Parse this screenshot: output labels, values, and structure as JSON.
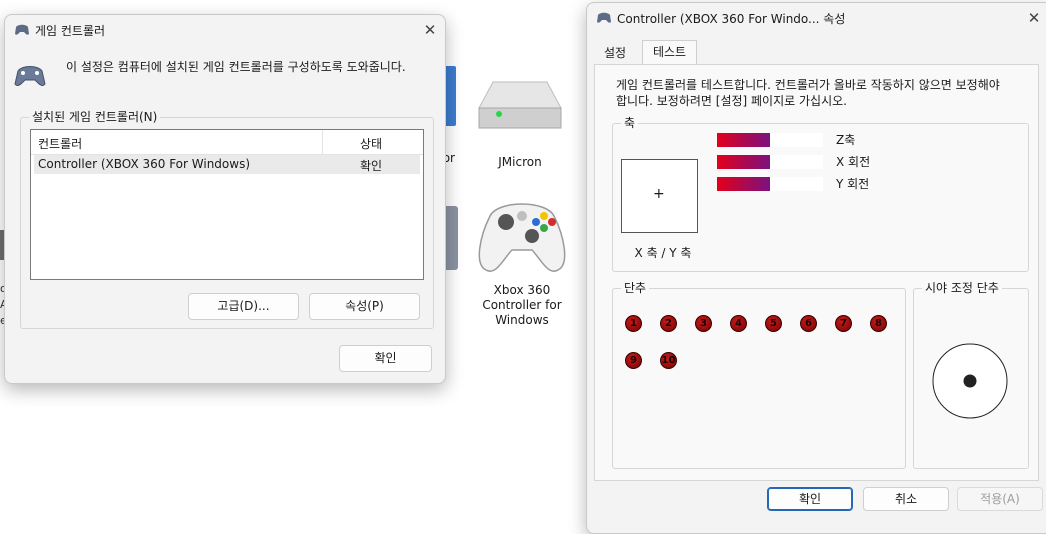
{
  "desktop": {
    "jmicron_label": "JMicron",
    "xbox_label_1": "Xbox 360",
    "xbox_label_2": "Controller for",
    "xbox_label_3": "Windows",
    "partial_tor": "tor",
    "partial_left_1": "o",
    "partial_left_2": "A",
    "partial_left_3": "e"
  },
  "game_controllers": {
    "title": "게임 컨트롤러",
    "description": "이 설정은 컴퓨터에 설치된 게임 컨트롤러를 구성하도록 도와줍니다.",
    "group_label": "설치된 게임 컨트롤러(N)",
    "columns": {
      "controller": "컨트롤러",
      "status": "상태"
    },
    "rows": [
      {
        "controller": "Controller (XBOX 360 For Windows)",
        "status": "확인"
      }
    ],
    "advanced_button": "고급(D)...",
    "properties_button": "속성(P)",
    "ok_button": "확인"
  },
  "properties": {
    "title": "Controller (XBOX 360 For Windo... 속성",
    "tabs": [
      {
        "label": "설정"
      },
      {
        "label": "테스트"
      }
    ],
    "active_tab": "테스트",
    "description_line1": "게임 컨트롤러를 테스트합니다. 컨트롤러가 올바로 작동하지 않으면 보정해야",
    "description_line2": "합니다. 보정하려면 [설정] 페이지로 가십시오.",
    "axes_group": "축",
    "xy_label": "X 축 / Y 축",
    "axis_bars": [
      {
        "label": "Z축",
        "level": 0.5
      },
      {
        "label": "X 회전",
        "level": 0.5
      },
      {
        "label": "Y 회전",
        "level": 0.5
      }
    ],
    "buttons_group": "단추",
    "buttons": [
      "1",
      "2",
      "3",
      "4",
      "5",
      "6",
      "7",
      "8",
      "9",
      "10"
    ],
    "pov_group": "시야 조정 단추",
    "ok_button": "확인",
    "cancel_button": "취소",
    "apply_button": "적용(A)",
    "colors": {
      "bar_start": "#e3001b",
      "bar_end": "#7b1180",
      "button_fill": "#8e0b0b"
    }
  }
}
